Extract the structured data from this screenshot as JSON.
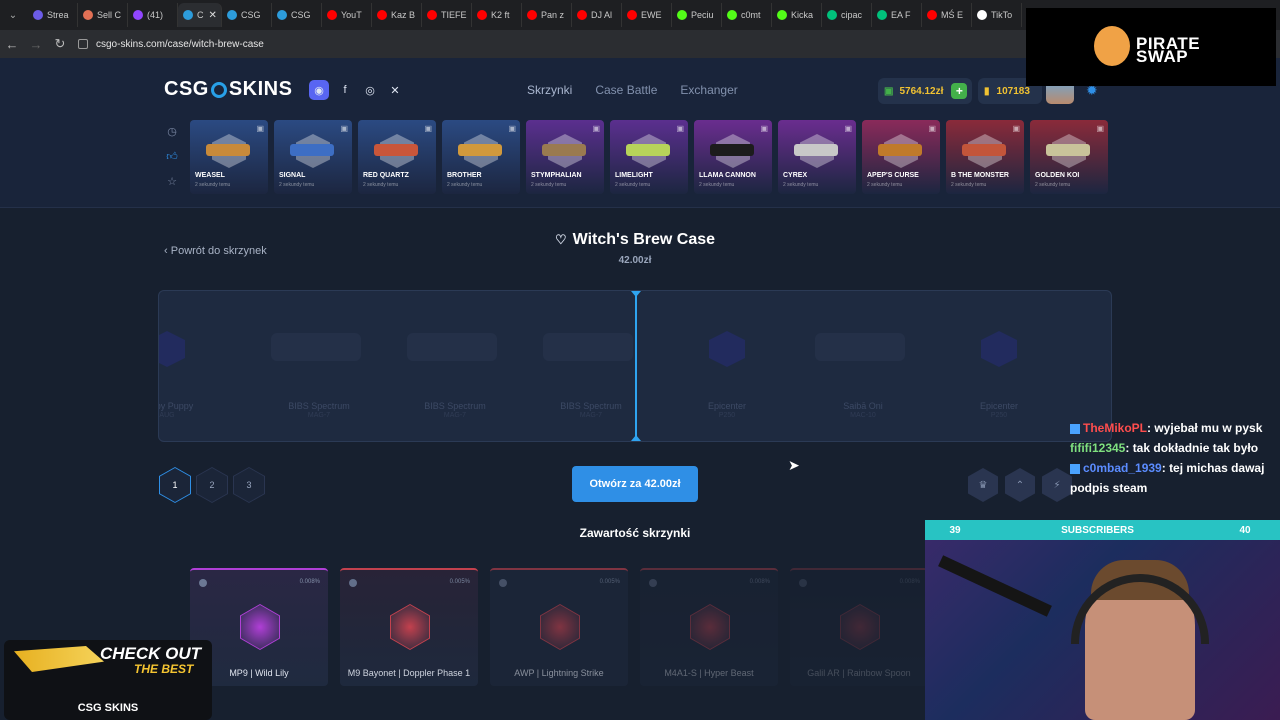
{
  "browser": {
    "tabs": [
      {
        "label": "Strea",
        "color": "#6c5ce7"
      },
      {
        "label": "Sell C",
        "color": "#e17055"
      },
      {
        "label": "(41)",
        "color": "#9146ff"
      },
      {
        "label": "C",
        "color": "#2d9cdb",
        "active": true
      },
      {
        "label": "CSG",
        "color": "#2d9cdb"
      },
      {
        "label": "CSG",
        "color": "#2d9cdb"
      },
      {
        "label": "YouT",
        "color": "#ff0000"
      },
      {
        "label": "Kaz B",
        "color": "#ff0000"
      },
      {
        "label": "TIEFE",
        "color": "#ff0000"
      },
      {
        "label": "K2 ft",
        "color": "#ff0000"
      },
      {
        "label": "Pan z",
        "color": "#ff0000"
      },
      {
        "label": "DJ Al",
        "color": "#ff0000"
      },
      {
        "label": "EWE",
        "color": "#ff0000"
      },
      {
        "label": "Peciu",
        "color": "#53fc18"
      },
      {
        "label": "c0mt",
        "color": "#53fc18"
      },
      {
        "label": "Kicka",
        "color": "#53fc18"
      },
      {
        "label": "cipac",
        "color": "#00c17b"
      },
      {
        "label": "EA F",
        "color": "#00c17b"
      },
      {
        "label": "MŚ E",
        "color": "#ff0000"
      },
      {
        "label": "TikTo",
        "color": "#ffffff"
      }
    ],
    "url": "csgo-skins.com/case/witch-brew-case"
  },
  "header": {
    "logo_left": "CSG",
    "logo_right": "SKINS",
    "nav": [
      "Skrzynki",
      "Case Battle",
      "Exchanger"
    ],
    "balance": "5764.12zł",
    "coins": "107183"
  },
  "live_drops": [
    {
      "name": "WEASEL",
      "time": "2 sekundy temu",
      "color": "#2b4a82",
      "gun": "#c88a3a"
    },
    {
      "name": "SIGNAL",
      "time": "2 sekundy temu",
      "color": "#2b4a82",
      "gun": "#3d6ec4"
    },
    {
      "name": "RED QUARTZ",
      "time": "2 sekundy temu",
      "color": "#2b4a82",
      "gun": "#c9563a"
    },
    {
      "name": "BROTHER",
      "time": "2 sekundy temu",
      "color": "#2b4a82",
      "gun": "#d1993c"
    },
    {
      "name": "STYMPHALIAN",
      "time": "2 sekundy temu",
      "color": "#5b2f8f",
      "gun": "#9a7a50"
    },
    {
      "name": "LIMELIGHT",
      "time": "2 sekundy temu",
      "color": "#5b2f8f",
      "gun": "#b7d45a"
    },
    {
      "name": "LLAMA CANNON",
      "time": "2 sekundy temu",
      "color": "#6a2d8f",
      "gun": "#1c1c1c"
    },
    {
      "name": "CYREX",
      "time": "2 sekundy temu",
      "color": "#6a2d8f",
      "gun": "#c8c8c8"
    },
    {
      "name": "APEP'S CURSE",
      "time": "2 sekundy temu",
      "color": "#8a2a5a",
      "gun": "#c07a2a"
    },
    {
      "name": "B THE MONSTER",
      "time": "2 sekundy temu",
      "color": "#8a2a3a",
      "gun": "#c3553a"
    },
    {
      "name": "GOLDEN KOI",
      "time": "2 sekundy temu",
      "color": "#8a2a3a",
      "gun": "#c9c39a"
    }
  ],
  "main": {
    "back_label": "Powrót do skrzynek",
    "case_title": "Witch's Brew Case",
    "case_price": "42.00zł",
    "roller": [
      {
        "name": "ath by Puppy",
        "sub": "AUG"
      },
      {
        "name": "BIBS Spectrum",
        "sub": "MAG-7"
      },
      {
        "name": "BIBS Spectrum",
        "sub": "MAG-7"
      },
      {
        "name": "BIBS Spectrum",
        "sub": "MAG-7"
      },
      {
        "name": "Epicenter",
        "sub": "P250"
      },
      {
        "name": "Saibā Oni",
        "sub": "MAC-10"
      },
      {
        "name": "Epicenter",
        "sub": "P250"
      }
    ],
    "quantities": [
      "1",
      "2",
      "3"
    ],
    "open_label": "Otwórz za 42.00zł",
    "contents_title": "Zawartość skrzynki",
    "contents": [
      {
        "name": "MP9 | Wild Lily",
        "prob": "0.008%",
        "color": "#b03fd6",
        "bg": "#2a2744"
      },
      {
        "name": "M9 Bayonet | Doppler Phase 1",
        "prob": "0.005%",
        "color": "#d64552",
        "bg": "#2a2438"
      },
      {
        "name": "AWP | Lightning Strike",
        "prob": "0.005%",
        "color": "#d64552",
        "bg": "#1f2a3f"
      },
      {
        "name": "M4A1-S | Hyper Beast",
        "prob": "0.008%",
        "color": "#d64552",
        "bg": "#1c2638"
      },
      {
        "name": "Galil AR | Rainbow Spoon",
        "prob": "0.008%",
        "color": "#d64552",
        "bg": "#1a2334"
      }
    ]
  },
  "overlay": {
    "sponsor": "PIRATE\nSWAP",
    "chat": [
      {
        "user": "TheMikoPL",
        "msg": ": wyjebał mu w pysk",
        "cls": "u1",
        "badge": true
      },
      {
        "user": "fififi12345",
        "msg": ": tak dokładnie tak było",
        "cls": "u2",
        "badge": false
      },
      {
        "user": "c0mbad_1939",
        "msg": ": tej michas dawaj podpis steam",
        "cls": "u3",
        "badge": true
      }
    ],
    "subs_current": "39",
    "subs_label": "SUBSCRIBERS",
    "subs_goal": "40",
    "promo_line1": "CHECK OUT",
    "promo_line2": "THE BEST",
    "promo_brand": "CSG SKINS"
  }
}
